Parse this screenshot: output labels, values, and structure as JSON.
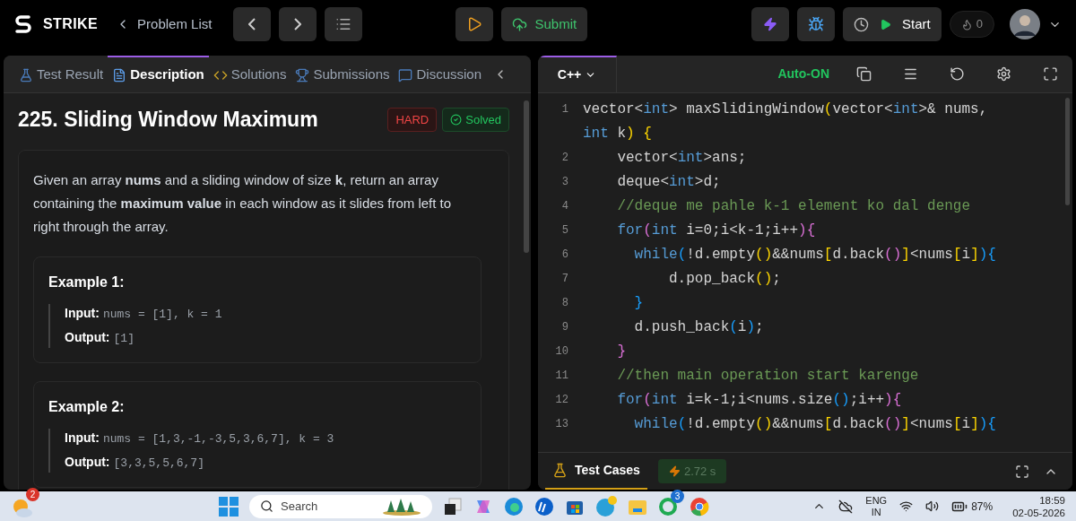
{
  "topbar": {
    "brand": "STRIKE",
    "back_link": "Problem List",
    "submit": "Submit",
    "start": "Start",
    "streak": "0"
  },
  "left_tabs": [
    {
      "label": "Test Result",
      "kind": "flask",
      "selected": false
    },
    {
      "label": "Description",
      "kind": "doc",
      "selected": true
    },
    {
      "label": "Solutions",
      "kind": "code",
      "selected": false
    },
    {
      "label": "Submissions",
      "kind": "trophy",
      "selected": false
    },
    {
      "label": "Discussion",
      "kind": "chat",
      "selected": false
    }
  ],
  "problem": {
    "title": "225. Sliding Window Maximum",
    "difficulty": "HARD",
    "status": "Solved",
    "statement": "Given an array **nums** and a sliding window of size **k**, return an array containing the **maximum value** in each window as it slides from left to right through the array.",
    "examples": [
      {
        "heading": "Example 1:",
        "rows": [
          {
            "label": "Input:",
            "value": "nums = [1], k = 1"
          },
          {
            "label": "Output:",
            "value": "[1]"
          }
        ]
      },
      {
        "heading": "Example 2:",
        "rows": [
          {
            "label": "Input:",
            "value": "nums = [1,3,-1,-3,5,3,6,7], k = 3"
          },
          {
            "label": "Output:",
            "value": "[3,3,5,5,6,7]"
          }
        ]
      }
    ]
  },
  "editor": {
    "language": "C++",
    "auto": "Auto-ON",
    "lines": [
      {
        "number": "1",
        "tokens": [
          {
            "text": "vector<",
            "kind": "plain"
          },
          {
            "text": "int",
            "kind": "type"
          },
          {
            "text": "> maxSlidingWindow",
            "kind": "plain"
          },
          {
            "text": "(",
            "kind": "bracket1"
          },
          {
            "text": "vector<",
            "kind": "plain"
          },
          {
            "text": "int",
            "kind": "type"
          },
          {
            "text": ">& nums, ",
            "kind": "plain"
          },
          {
            "text": "int",
            "kind": "type"
          },
          {
            "text": " k",
            "kind": "plain"
          },
          {
            "text": ")",
            "kind": "bracket1"
          },
          {
            "text": " {",
            "kind": "bracket1"
          }
        ]
      },
      {
        "number": "2",
        "tokens": [
          {
            "text": "    vector<",
            "kind": "plain"
          },
          {
            "text": "int",
            "kind": "type"
          },
          {
            "text": ">ans;",
            "kind": "plain"
          }
        ]
      },
      {
        "number": "3",
        "tokens": [
          {
            "text": "    deque<",
            "kind": "plain"
          },
          {
            "text": "int",
            "kind": "type"
          },
          {
            "text": ">d;",
            "kind": "plain"
          }
        ]
      },
      {
        "number": "4",
        "tokens": [
          {
            "text": "    //deque me pahle k-1 element ko dal denge",
            "kind": "comment"
          }
        ]
      },
      {
        "number": "5",
        "tokens": [
          {
            "text": "    for",
            "kind": "type"
          },
          {
            "text": "(",
            "kind": "bracket2"
          },
          {
            "text": "int",
            "kind": "type"
          },
          {
            "text": " i=0;i<k-1;i++",
            "kind": "plain"
          },
          {
            "text": ")",
            "kind": "bracket2"
          },
          {
            "text": "{",
            "kind": "bracket2"
          }
        ]
      },
      {
        "number": "6",
        "tokens": [
          {
            "text": "      while",
            "kind": "type"
          },
          {
            "text": "(",
            "kind": "bracket3"
          },
          {
            "text": "!d.empty",
            "kind": "plain"
          },
          {
            "text": "()",
            "kind": "bracket1"
          },
          {
            "text": "&&nums",
            "kind": "plain"
          },
          {
            "text": "[",
            "kind": "bracket1"
          },
          {
            "text": "d.back",
            "kind": "plain"
          },
          {
            "text": "()",
            "kind": "bracket2"
          },
          {
            "text": "]",
            "kind": "bracket1"
          },
          {
            "text": "<nums",
            "kind": "plain"
          },
          {
            "text": "[",
            "kind": "bracket1"
          },
          {
            "text": "i",
            "kind": "plain"
          },
          {
            "text": "]",
            "kind": "bracket1"
          },
          {
            "text": ")",
            "kind": "bracket3"
          },
          {
            "text": "{",
            "kind": "bracket3"
          }
        ]
      },
      {
        "number": "7",
        "tokens": [
          {
            "text": "          d.pop_back",
            "kind": "plain"
          },
          {
            "text": "()",
            "kind": "bracket1"
          },
          {
            "text": ";",
            "kind": "plain"
          }
        ]
      },
      {
        "number": "8",
        "tokens": [
          {
            "text": "      }",
            "kind": "bracket3"
          }
        ]
      },
      {
        "number": "9",
        "tokens": [
          {
            "text": "      d.push_back",
            "kind": "plain"
          },
          {
            "text": "(",
            "kind": "bracket3"
          },
          {
            "text": "i",
            "kind": "plain"
          },
          {
            "text": ")",
            "kind": "bracket3"
          },
          {
            "text": ";",
            "kind": "plain"
          }
        ]
      },
      {
        "number": "10",
        "tokens": [
          {
            "text": "    }",
            "kind": "bracket2"
          }
        ]
      },
      {
        "number": "11",
        "tokens": [
          {
            "text": "    //then main operation start karenge",
            "kind": "comment"
          }
        ]
      },
      {
        "number": "12",
        "tokens": [
          {
            "text": "    for",
            "kind": "type"
          },
          {
            "text": "(",
            "kind": "bracket2"
          },
          {
            "text": "int",
            "kind": "type"
          },
          {
            "text": " i=k-1;i<nums.size",
            "kind": "plain"
          },
          {
            "text": "()",
            "kind": "bracket3"
          },
          {
            "text": ";i++",
            "kind": "plain"
          },
          {
            "text": ")",
            "kind": "bracket2"
          },
          {
            "text": "{",
            "kind": "bracket2"
          }
        ]
      },
      {
        "number": "13",
        "tokens": [
          {
            "text": "      while",
            "kind": "type"
          },
          {
            "text": "(",
            "kind": "bracket3"
          },
          {
            "text": "!d.empty",
            "kind": "plain"
          },
          {
            "text": "()",
            "kind": "bracket1"
          },
          {
            "text": "&&nums",
            "kind": "plain"
          },
          {
            "text": "[",
            "kind": "bracket1"
          },
          {
            "text": "d.back",
            "kind": "plain"
          },
          {
            "text": "()",
            "kind": "bracket2"
          },
          {
            "text": "]",
            "kind": "bracket1"
          },
          {
            "text": "<nums",
            "kind": "plain"
          },
          {
            "text": "[",
            "kind": "bracket1"
          },
          {
            "text": "i",
            "kind": "plain"
          },
          {
            "text": "]",
            "kind": "bracket1"
          },
          {
            "text": ")",
            "kind": "bracket3"
          },
          {
            "text": "{",
            "kind": "bracket3"
          }
        ]
      }
    ]
  },
  "bottom_panel": {
    "tab": "Test Cases",
    "runtime": "2.72 s"
  },
  "taskbar": {
    "weather_badge": "2",
    "search": "Search",
    "whatsapp_badge": "3",
    "language": "ENG",
    "region": "IN",
    "battery": "87%",
    "time": "18:59",
    "date": "02-05-2026"
  }
}
